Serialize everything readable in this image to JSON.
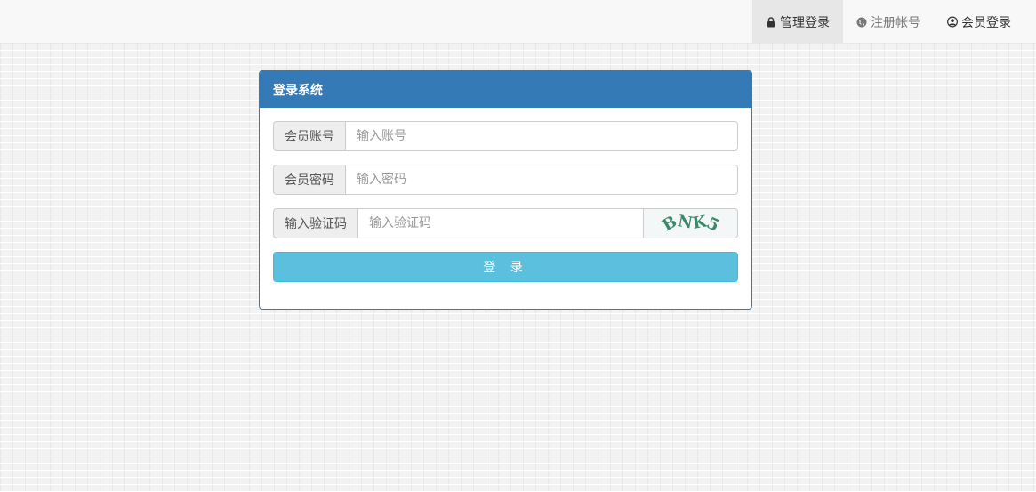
{
  "nav": {
    "items": [
      {
        "label": "管理登录",
        "icon": "lock-icon",
        "active": true
      },
      {
        "label": "注册帐号",
        "icon": "globe-icon",
        "active": false
      },
      {
        "label": "会员登录",
        "icon": "user-circle-icon",
        "active": false
      }
    ]
  },
  "panel": {
    "title": "登录系统",
    "account": {
      "label": "会员账号",
      "placeholder": "输入账号",
      "value": ""
    },
    "password": {
      "label": "会员密码",
      "placeholder": "输入密码",
      "value": ""
    },
    "captcha": {
      "label": "输入验证码",
      "placeholder": "输入验证码",
      "value": "",
      "image_text": "BNK5"
    },
    "submit_label": "登 录"
  },
  "colors": {
    "primary": "#337ab7",
    "info_button": "#5bc0de",
    "captcha_text": "#3a8a6a"
  }
}
